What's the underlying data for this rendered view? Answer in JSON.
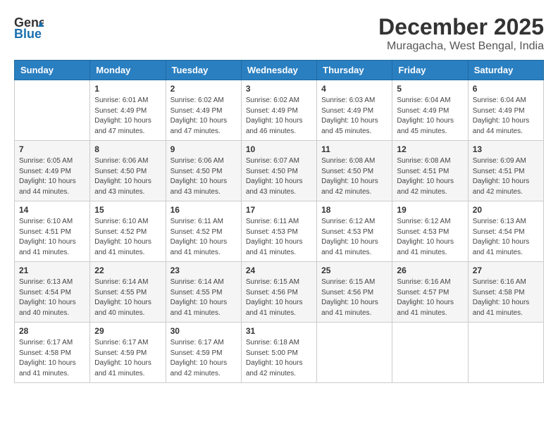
{
  "header": {
    "logo_general": "General",
    "logo_blue": "Blue",
    "title": "December 2025",
    "subtitle": "Muragacha, West Bengal, India"
  },
  "days_of_week": [
    "Sunday",
    "Monday",
    "Tuesday",
    "Wednesday",
    "Thursday",
    "Friday",
    "Saturday"
  ],
  "weeks": [
    [
      {
        "day": "",
        "info": ""
      },
      {
        "day": "1",
        "info": "Sunrise: 6:01 AM\nSunset: 4:49 PM\nDaylight: 10 hours\nand 47 minutes."
      },
      {
        "day": "2",
        "info": "Sunrise: 6:02 AM\nSunset: 4:49 PM\nDaylight: 10 hours\nand 47 minutes."
      },
      {
        "day": "3",
        "info": "Sunrise: 6:02 AM\nSunset: 4:49 PM\nDaylight: 10 hours\nand 46 minutes."
      },
      {
        "day": "4",
        "info": "Sunrise: 6:03 AM\nSunset: 4:49 PM\nDaylight: 10 hours\nand 45 minutes."
      },
      {
        "day": "5",
        "info": "Sunrise: 6:04 AM\nSunset: 4:49 PM\nDaylight: 10 hours\nand 45 minutes."
      },
      {
        "day": "6",
        "info": "Sunrise: 6:04 AM\nSunset: 4:49 PM\nDaylight: 10 hours\nand 44 minutes."
      }
    ],
    [
      {
        "day": "7",
        "info": "Sunrise: 6:05 AM\nSunset: 4:49 PM\nDaylight: 10 hours\nand 44 minutes."
      },
      {
        "day": "8",
        "info": "Sunrise: 6:06 AM\nSunset: 4:50 PM\nDaylight: 10 hours\nand 43 minutes."
      },
      {
        "day": "9",
        "info": "Sunrise: 6:06 AM\nSunset: 4:50 PM\nDaylight: 10 hours\nand 43 minutes."
      },
      {
        "day": "10",
        "info": "Sunrise: 6:07 AM\nSunset: 4:50 PM\nDaylight: 10 hours\nand 43 minutes."
      },
      {
        "day": "11",
        "info": "Sunrise: 6:08 AM\nSunset: 4:50 PM\nDaylight: 10 hours\nand 42 minutes."
      },
      {
        "day": "12",
        "info": "Sunrise: 6:08 AM\nSunset: 4:51 PM\nDaylight: 10 hours\nand 42 minutes."
      },
      {
        "day": "13",
        "info": "Sunrise: 6:09 AM\nSunset: 4:51 PM\nDaylight: 10 hours\nand 42 minutes."
      }
    ],
    [
      {
        "day": "14",
        "info": "Sunrise: 6:10 AM\nSunset: 4:51 PM\nDaylight: 10 hours\nand 41 minutes."
      },
      {
        "day": "15",
        "info": "Sunrise: 6:10 AM\nSunset: 4:52 PM\nDaylight: 10 hours\nand 41 minutes."
      },
      {
        "day": "16",
        "info": "Sunrise: 6:11 AM\nSunset: 4:52 PM\nDaylight: 10 hours\nand 41 minutes."
      },
      {
        "day": "17",
        "info": "Sunrise: 6:11 AM\nSunset: 4:53 PM\nDaylight: 10 hours\nand 41 minutes."
      },
      {
        "day": "18",
        "info": "Sunrise: 6:12 AM\nSunset: 4:53 PM\nDaylight: 10 hours\nand 41 minutes."
      },
      {
        "day": "19",
        "info": "Sunrise: 6:12 AM\nSunset: 4:53 PM\nDaylight: 10 hours\nand 41 minutes."
      },
      {
        "day": "20",
        "info": "Sunrise: 6:13 AM\nSunset: 4:54 PM\nDaylight: 10 hours\nand 41 minutes."
      }
    ],
    [
      {
        "day": "21",
        "info": "Sunrise: 6:13 AM\nSunset: 4:54 PM\nDaylight: 10 hours\nand 40 minutes."
      },
      {
        "day": "22",
        "info": "Sunrise: 6:14 AM\nSunset: 4:55 PM\nDaylight: 10 hours\nand 40 minutes."
      },
      {
        "day": "23",
        "info": "Sunrise: 6:14 AM\nSunset: 4:55 PM\nDaylight: 10 hours\nand 41 minutes."
      },
      {
        "day": "24",
        "info": "Sunrise: 6:15 AM\nSunset: 4:56 PM\nDaylight: 10 hours\nand 41 minutes."
      },
      {
        "day": "25",
        "info": "Sunrise: 6:15 AM\nSunset: 4:56 PM\nDaylight: 10 hours\nand 41 minutes."
      },
      {
        "day": "26",
        "info": "Sunrise: 6:16 AM\nSunset: 4:57 PM\nDaylight: 10 hours\nand 41 minutes."
      },
      {
        "day": "27",
        "info": "Sunrise: 6:16 AM\nSunset: 4:58 PM\nDaylight: 10 hours\nand 41 minutes."
      }
    ],
    [
      {
        "day": "28",
        "info": "Sunrise: 6:17 AM\nSunset: 4:58 PM\nDaylight: 10 hours\nand 41 minutes."
      },
      {
        "day": "29",
        "info": "Sunrise: 6:17 AM\nSunset: 4:59 PM\nDaylight: 10 hours\nand 41 minutes."
      },
      {
        "day": "30",
        "info": "Sunrise: 6:17 AM\nSunset: 4:59 PM\nDaylight: 10 hours\nand 42 minutes."
      },
      {
        "day": "31",
        "info": "Sunrise: 6:18 AM\nSunset: 5:00 PM\nDaylight: 10 hours\nand 42 minutes."
      },
      {
        "day": "",
        "info": ""
      },
      {
        "day": "",
        "info": ""
      },
      {
        "day": "",
        "info": ""
      }
    ]
  ]
}
